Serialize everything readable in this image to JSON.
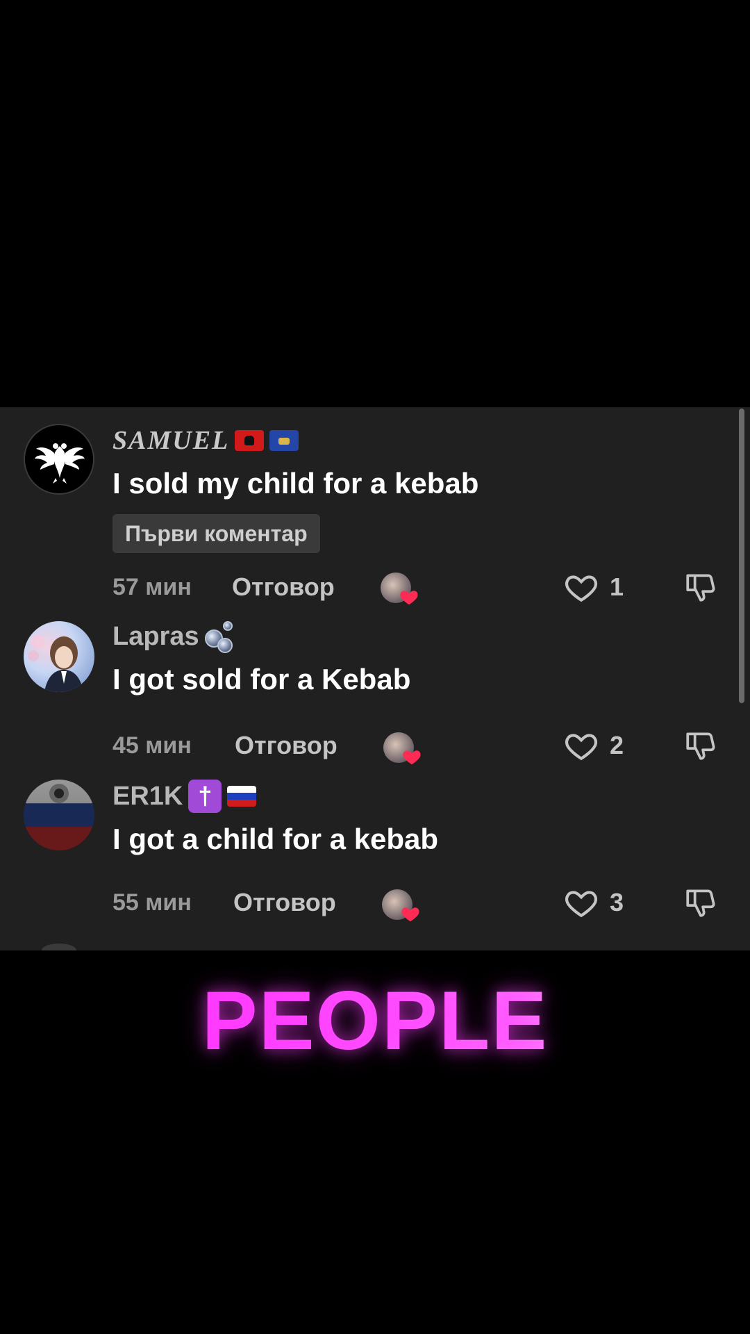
{
  "comments": [
    {
      "username": "SAMUEL",
      "text": "I sold my child for a kebab",
      "tag": "Първи коментар",
      "time": "57 мин",
      "reply": "Отговор",
      "likes": "1"
    },
    {
      "username": "Lapras",
      "text": "I got sold for a Kebab",
      "time": "45 мин",
      "reply": "Отговор",
      "likes": "2"
    },
    {
      "username": "ER1K",
      "text": "I got a child for a kebab",
      "time": "55 мин",
      "reply": "Отговор",
      "likes": "3"
    }
  ],
  "overlay": {
    "title": "PEOPLE"
  },
  "colors": {
    "panel": "#202020",
    "accent": "#ff4dff",
    "heart": "#fe2c55"
  }
}
